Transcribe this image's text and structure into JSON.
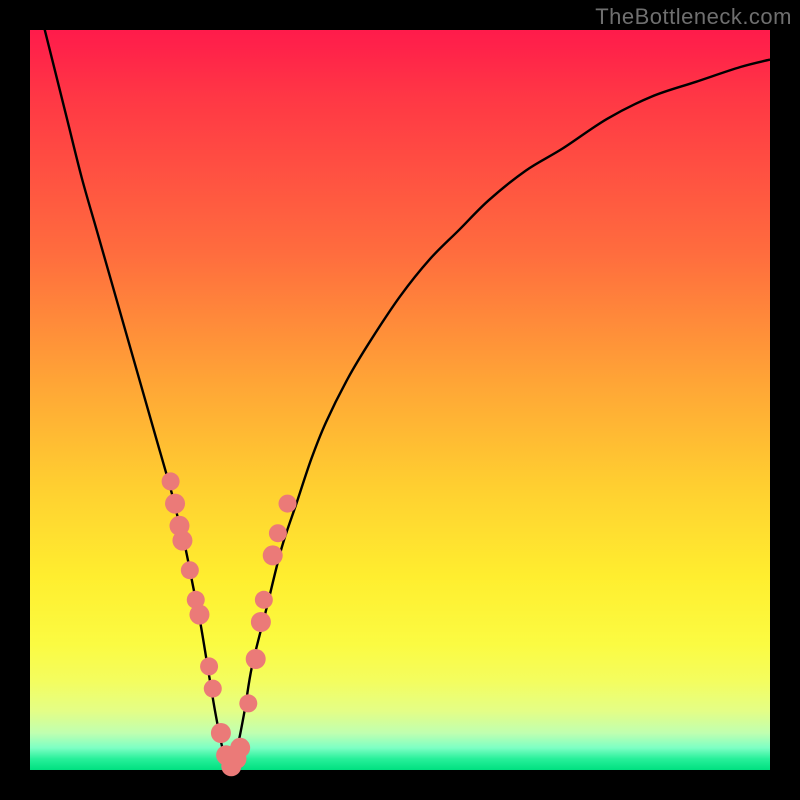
{
  "watermark": "TheBottleneck.com",
  "colors": {
    "curve": "#000000",
    "dot_fill": "#eb7a78",
    "dot_stroke": "#eb7a78"
  },
  "chart_data": {
    "type": "line",
    "title": "",
    "xlabel": "",
    "ylabel": "",
    "xlim": [
      0,
      100
    ],
    "ylim": [
      0,
      100
    ],
    "grid": false,
    "series": [
      {
        "name": "bottleneck-curve",
        "x": [
          1,
          3,
          5,
          7,
          9,
          11,
          13,
          15,
          17,
          19,
          20,
          21,
          22,
          23,
          24,
          25,
          26,
          27,
          28,
          29,
          30,
          32,
          34,
          36,
          38,
          40,
          43,
          46,
          50,
          54,
          58,
          62,
          67,
          72,
          78,
          84,
          90,
          96,
          100
        ],
        "values": [
          104,
          96,
          88,
          80,
          73,
          66,
          59,
          52,
          45,
          38,
          34,
          30,
          25,
          20,
          14,
          8,
          3,
          0,
          3,
          8,
          14,
          22,
          30,
          36,
          42,
          47,
          53,
          58,
          64,
          69,
          73,
          77,
          81,
          84,
          88,
          91,
          93,
          95,
          96
        ]
      }
    ],
    "scatter": [
      {
        "name": "sample-points",
        "x": [
          19.0,
          19.6,
          20.2,
          20.6,
          21.6,
          22.4,
          22.9,
          24.2,
          24.7,
          25.8,
          26.5,
          27.2,
          27.9,
          28.4,
          29.5,
          30.5,
          31.2,
          31.6,
          32.8,
          33.5,
          34.8
        ],
        "values": [
          39,
          36,
          33,
          31,
          27,
          23,
          21,
          14,
          11,
          5,
          2,
          0.5,
          1.5,
          3,
          9,
          15,
          20,
          23,
          29,
          32,
          36
        ],
        "r": [
          9,
          10,
          10,
          10,
          9,
          9,
          10,
          9,
          9,
          10,
          10,
          10,
          10,
          10,
          9,
          10,
          10,
          9,
          10,
          9,
          9
        ]
      }
    ]
  }
}
